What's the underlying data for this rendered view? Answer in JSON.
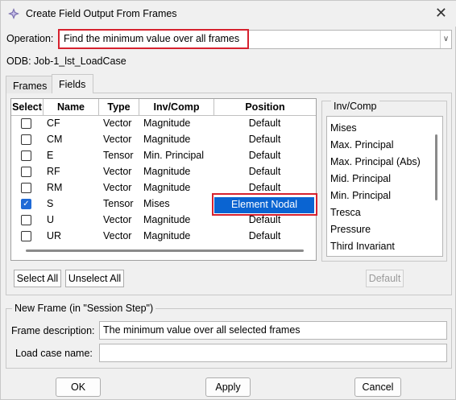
{
  "window": {
    "title": "Create Field Output From Frames",
    "close_label": "✕"
  },
  "operation": {
    "label": "Operation:",
    "value": "Find the minimum value over all frames"
  },
  "odb": {
    "label": "ODB: Job-1_lst_LoadCase"
  },
  "tabs": [
    {
      "label": "Frames"
    },
    {
      "label": "Fields"
    }
  ],
  "fields_table": {
    "headers": [
      "Select",
      "Name",
      "Type",
      "Inv/Comp",
      "Position"
    ],
    "rows": [
      {
        "checked": false,
        "name": "CF",
        "type": "Vector",
        "invcomp": "Magnitude",
        "position": "Default"
      },
      {
        "checked": false,
        "name": "CM",
        "type": "Vector",
        "invcomp": "Magnitude",
        "position": "Default"
      },
      {
        "checked": false,
        "name": "E",
        "type": "Tensor",
        "invcomp": "Min. Principal",
        "position": "Default"
      },
      {
        "checked": false,
        "name": "RF",
        "type": "Vector",
        "invcomp": "Magnitude",
        "position": "Default"
      },
      {
        "checked": false,
        "name": "RM",
        "type": "Vector",
        "invcomp": "Magnitude",
        "position": "Default"
      },
      {
        "checked": true,
        "name": "S",
        "type": "Tensor",
        "invcomp": "Mises",
        "position": "Element Nodal"
      },
      {
        "checked": false,
        "name": "U",
        "type": "Vector",
        "invcomp": "Magnitude",
        "position": "Default"
      },
      {
        "checked": false,
        "name": "UR",
        "type": "Vector",
        "invcomp": "Magnitude",
        "position": "Default"
      }
    ]
  },
  "invcomp_panel": {
    "legend": "Inv/Comp",
    "items": [
      "Mises",
      "Max. Principal",
      "Max. Principal (Abs)",
      "Mid. Principal",
      "Min. Principal",
      "Tresca",
      "Pressure",
      "Third Invariant"
    ]
  },
  "buttons": {
    "select_all": "Select All",
    "unselect_all": "Unselect All",
    "default": "Default"
  },
  "new_frame": {
    "legend": "New Frame (in \"Session Step\")",
    "desc_label": "Frame description:",
    "desc_value": "The minimum value over all selected frames",
    "load_case_label": "Load case name:",
    "load_case_value": ""
  },
  "footer": {
    "ok": "OK",
    "apply": "Apply",
    "cancel": "Cancel"
  },
  "colors": {
    "highlight": "#d6212e",
    "selection": "#0a64d2",
    "checkbox": "#1f6ad6"
  }
}
